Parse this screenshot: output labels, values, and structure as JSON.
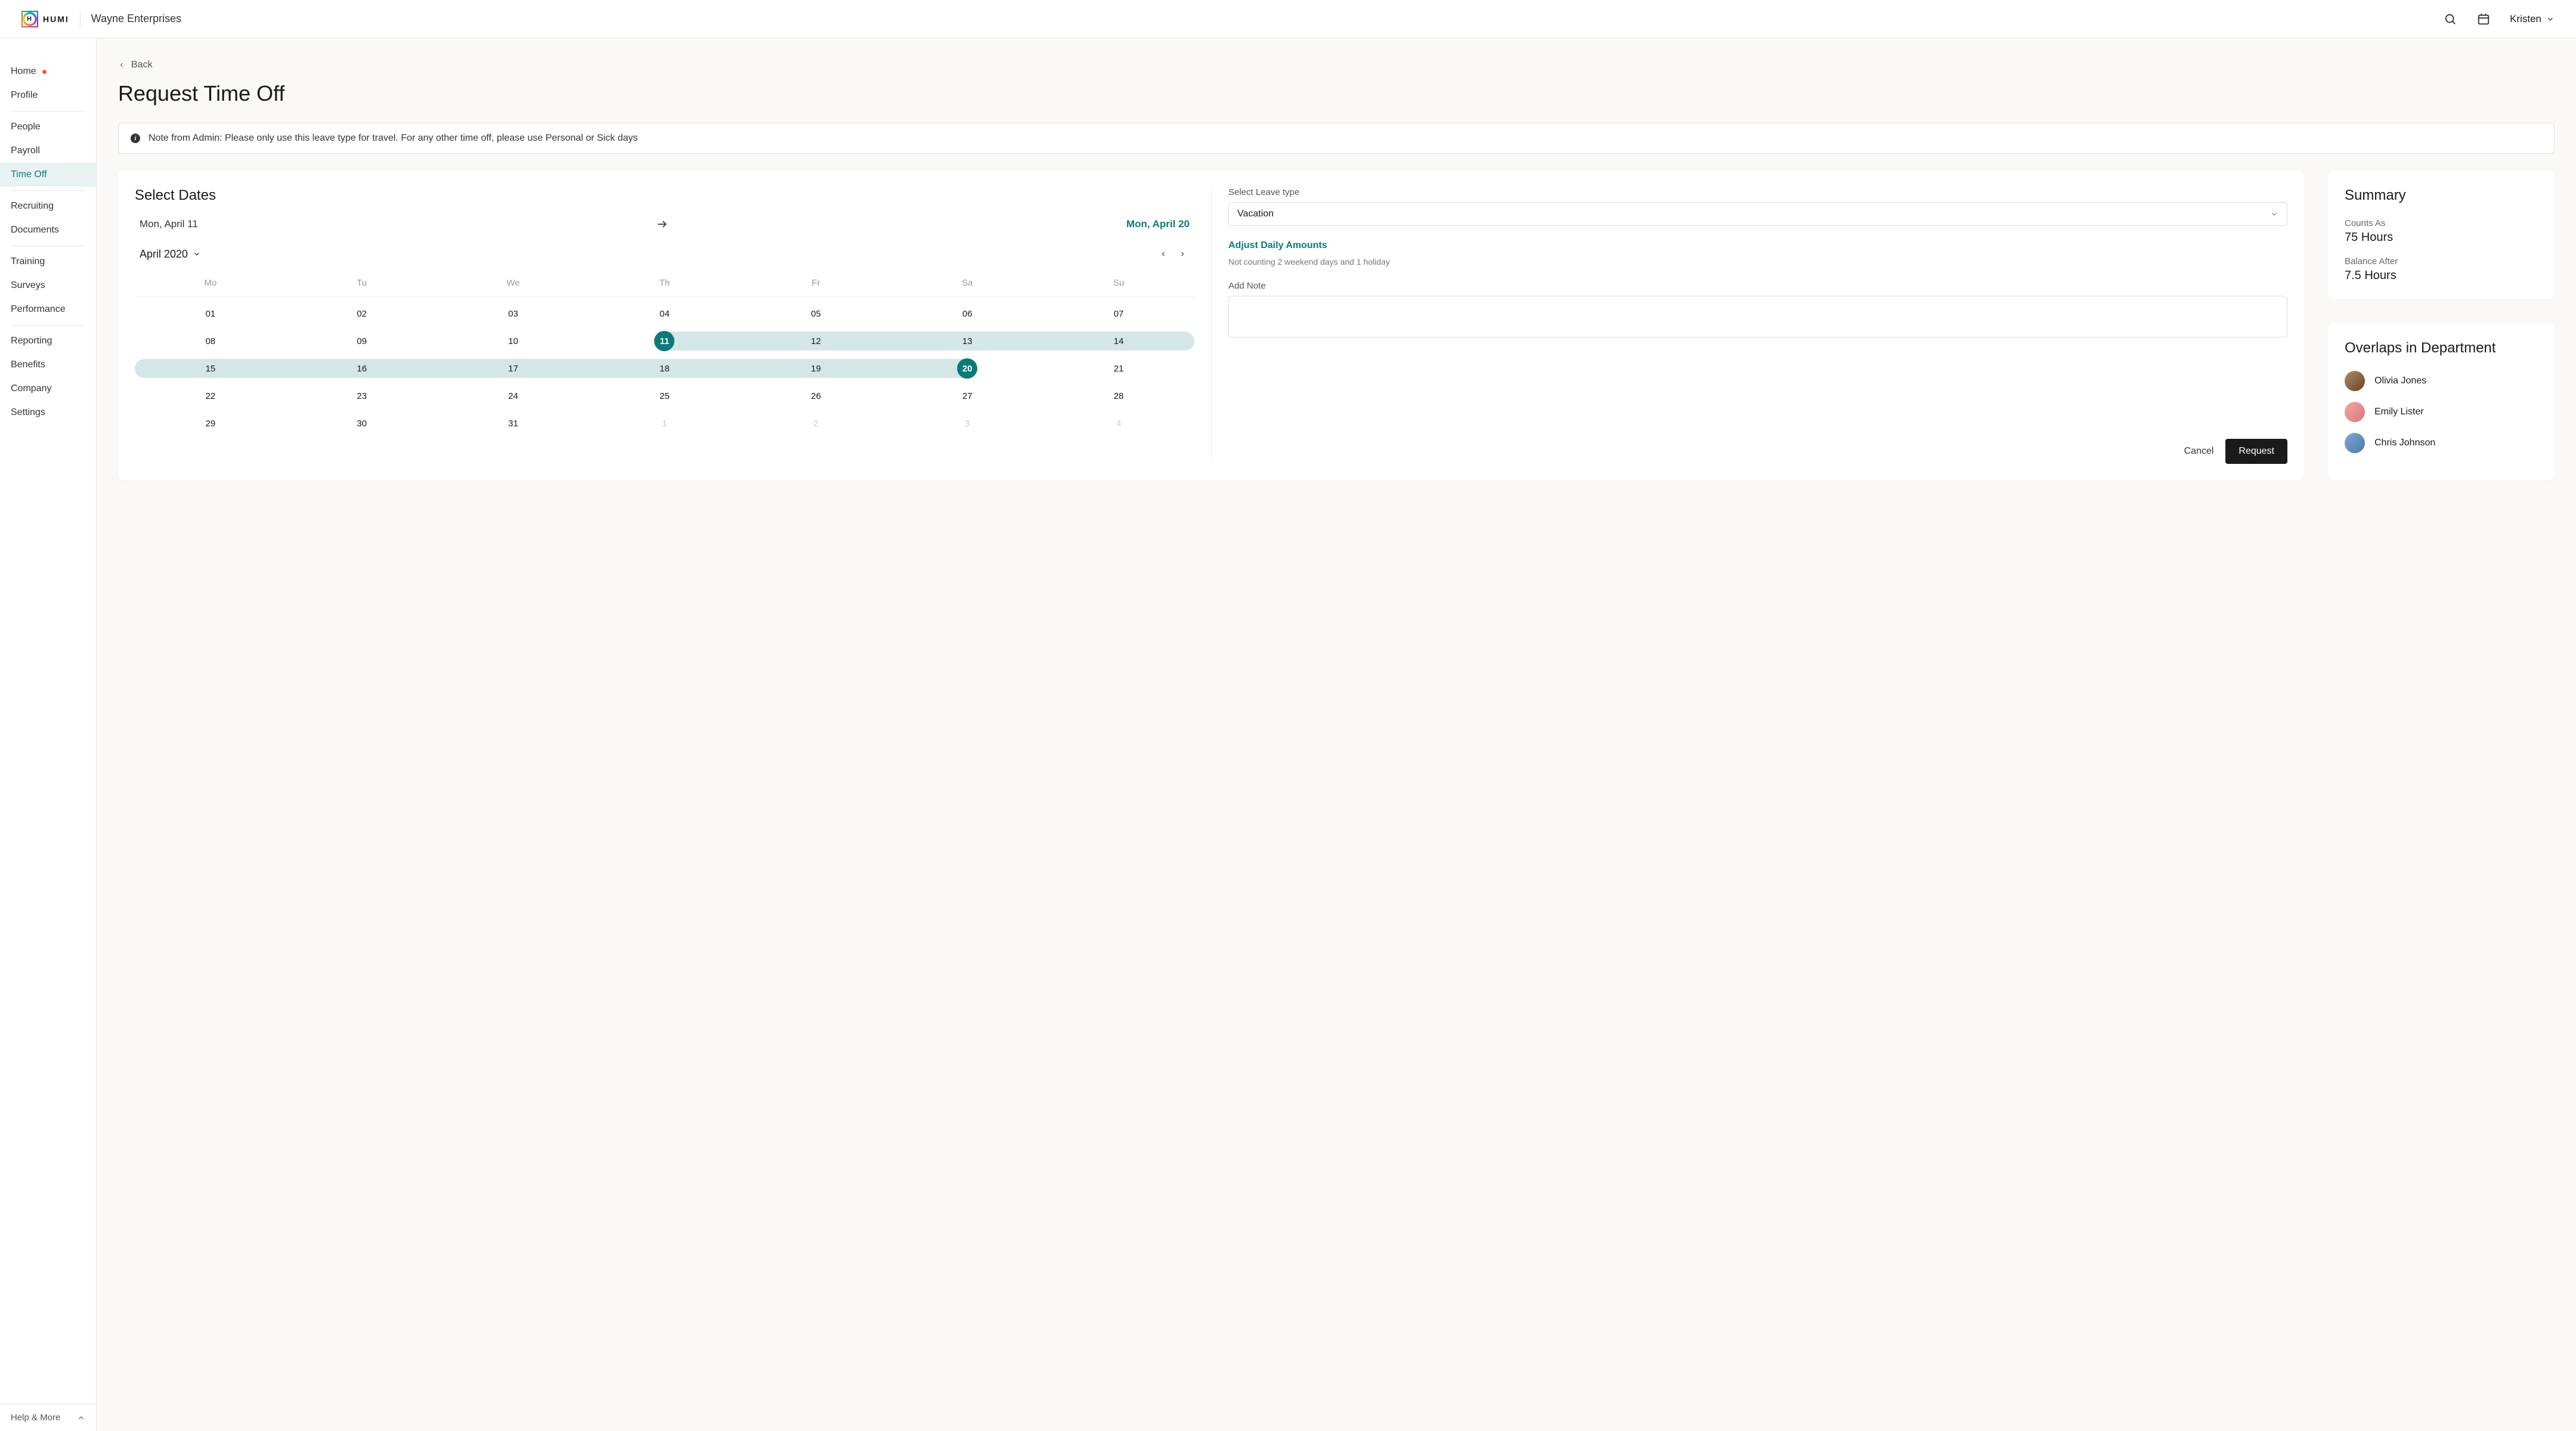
{
  "header": {
    "logo_text": "HUMI",
    "company": "Wayne Enterprises",
    "user_name": "Kristen"
  },
  "sidebar": {
    "items": [
      {
        "label": "Home",
        "has_dot": true
      },
      {
        "label": "Profile"
      },
      {
        "divider": true
      },
      {
        "label": "People"
      },
      {
        "label": "Payroll"
      },
      {
        "label": "Time Off",
        "active": true
      },
      {
        "divider": true
      },
      {
        "label": "Recruiting"
      },
      {
        "label": "Documents"
      },
      {
        "divider": true
      },
      {
        "label": "Training"
      },
      {
        "label": "Surveys"
      },
      {
        "label": "Performance"
      },
      {
        "divider": true
      },
      {
        "label": "Reporting"
      },
      {
        "label": "Benefits"
      },
      {
        "label": "Company"
      },
      {
        "label": "Settings"
      }
    ],
    "footer": "Help & More"
  },
  "page": {
    "back": "Back",
    "title": "Request Time Off",
    "admin_note": "Note from Admin: Please only use this leave type for travel. For any other time off, please use Personal or Sick days"
  },
  "dates": {
    "section_title": "Select Dates",
    "from": "Mon, April 11",
    "to": "Mon, April 20",
    "month_label": "April 2020",
    "dow": [
      "Mo",
      "Tu",
      "We",
      "Th",
      "Fr",
      "Sa",
      "Su"
    ],
    "weeks": [
      [
        {
          "d": "01"
        },
        {
          "d": "02"
        },
        {
          "d": "03"
        },
        {
          "d": "04"
        },
        {
          "d": "05"
        },
        {
          "d": "06"
        },
        {
          "d": "07"
        }
      ],
      [
        {
          "d": "08"
        },
        {
          "d": "09"
        },
        {
          "d": "10"
        },
        {
          "d": "11",
          "sel": true,
          "range": "start"
        },
        {
          "d": "12",
          "range": "mid"
        },
        {
          "d": "13",
          "range": "mid"
        },
        {
          "d": "14",
          "range": "mid",
          "row_end": true
        }
      ],
      [
        {
          "d": "15",
          "range": "mid",
          "row_start": true
        },
        {
          "d": "16",
          "range": "mid"
        },
        {
          "d": "17",
          "range": "mid"
        },
        {
          "d": "18",
          "range": "mid"
        },
        {
          "d": "19",
          "range": "mid"
        },
        {
          "d": "20",
          "sel": true,
          "range": "end"
        },
        {
          "d": "21"
        }
      ],
      [
        {
          "d": "22"
        },
        {
          "d": "23"
        },
        {
          "d": "24"
        },
        {
          "d": "25"
        },
        {
          "d": "26"
        },
        {
          "d": "27"
        },
        {
          "d": "28"
        }
      ],
      [
        {
          "d": "29"
        },
        {
          "d": "30"
        },
        {
          "d": "31"
        },
        {
          "d": "1",
          "muted": true
        },
        {
          "d": "2",
          "muted": true
        },
        {
          "d": "3",
          "muted": true
        },
        {
          "d": "4",
          "muted": true
        }
      ]
    ]
  },
  "form": {
    "leave_type_label": "Select Leave type",
    "leave_type_value": "Vacation",
    "adjust_link": "Adjust Daily Amounts",
    "exclusion_note": "Not counting 2 weekend days and 1 holiday",
    "add_note_label": "Add Note",
    "cancel": "Cancel",
    "request": "Request"
  },
  "summary": {
    "title": "Summary",
    "counts_as_label": "Counts As",
    "counts_as_value": "75 Hours",
    "balance_after_label": "Balance After",
    "balance_after_value": "7.5 Hours"
  },
  "overlaps": {
    "title": "Overlaps in Department",
    "people": [
      {
        "name": "Olivia Jones"
      },
      {
        "name": "Emily Lister"
      },
      {
        "name": "Chris Johnson"
      }
    ]
  }
}
